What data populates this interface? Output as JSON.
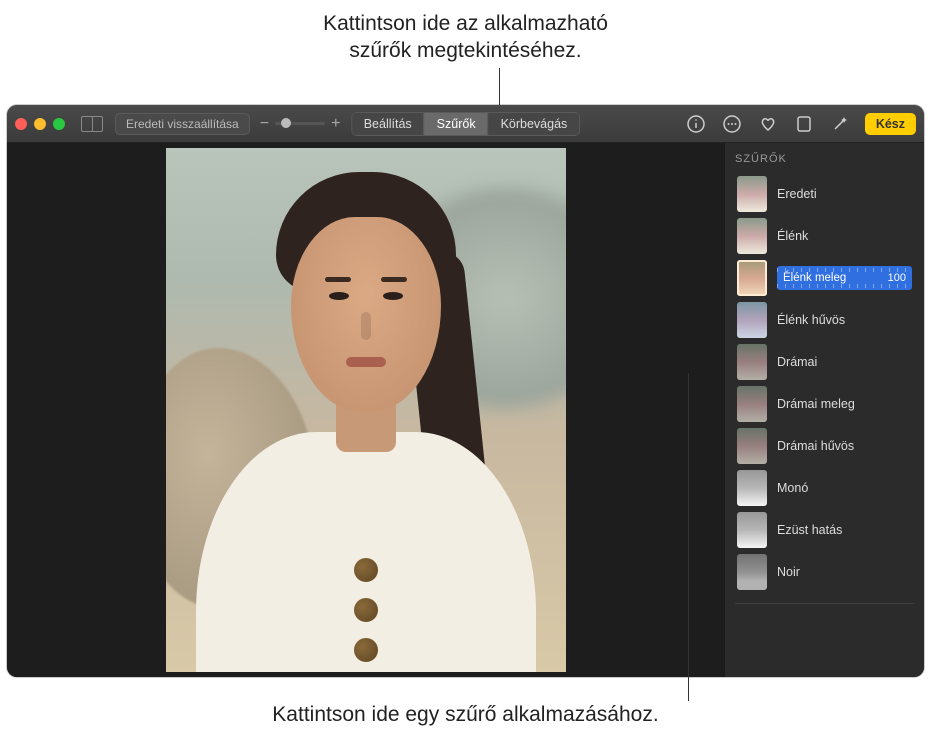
{
  "callouts": {
    "top_line1": "Kattintson ide az alkalmazható",
    "top_line2": "szűrők megtekintéséhez.",
    "bottom": "Kattintson ide egy szűrő alkalmazásához."
  },
  "toolbar": {
    "reset_label": "Eredeti visszaállítása",
    "zoom_minus": "−",
    "zoom_plus": "+",
    "segments": {
      "adjust": "Beállítás",
      "filters": "Szűrők",
      "crop": "Körbevágás"
    },
    "done_label": "Kész"
  },
  "icons": {
    "info": "info-icon",
    "more": "more-icon",
    "favorite": "heart-icon",
    "aspect": "aspect-icon",
    "wand": "wand-icon"
  },
  "sidebar": {
    "title": "SZŰRŐK",
    "selected_value": "100",
    "filters": [
      {
        "label": "Eredeti",
        "thumb_class": ""
      },
      {
        "label": "Élénk",
        "thumb_class": ""
      },
      {
        "label": "Élénk meleg",
        "thumb_class": "warm",
        "selected": true
      },
      {
        "label": "Élénk hűvös",
        "thumb_class": "cool"
      },
      {
        "label": "Drámai",
        "thumb_class": "dram"
      },
      {
        "label": "Drámai meleg",
        "thumb_class": "dram warm"
      },
      {
        "label": "Drámai hűvös",
        "thumb_class": "dram cool"
      },
      {
        "label": "Monó",
        "thumb_class": "bw"
      },
      {
        "label": "Ezüst hatás",
        "thumb_class": "bw"
      },
      {
        "label": "Noir",
        "thumb_class": "noir"
      }
    ]
  }
}
